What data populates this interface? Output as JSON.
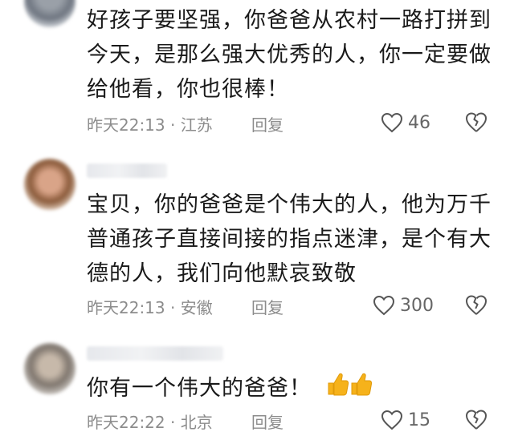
{
  "comments": [
    {
      "lines": [
        "好孩子要坚强，你爸爸从农村一路打拼到",
        "今天，是那么强大优秀的人，你一定要做",
        "给他看，你也很棒！"
      ],
      "time_location": "昨天22:13 · 江苏",
      "reply": "回复",
      "likes": "46"
    },
    {
      "lines": [
        "宝贝，你的爸爸是个伟大的人，他为万千",
        "普通孩子直接间接的指点迷津，是个有大",
        "德的人，我们向他默哀致敬"
      ],
      "time_location": "昨天22:13 · 安徽",
      "reply": "回复",
      "likes": "300"
    },
    {
      "lines": [
        "你有一个伟大的爸爸！"
      ],
      "emoji": "thumbs-up-icon x2",
      "time_location": "昨天22:22 · 北京",
      "reply": "回复",
      "likes": "15"
    }
  ]
}
